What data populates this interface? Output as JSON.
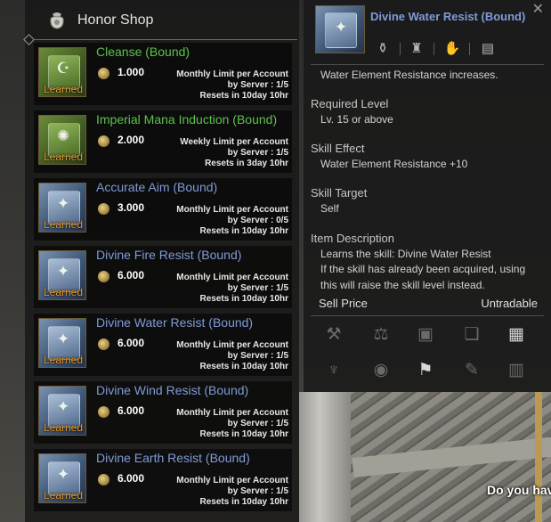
{
  "background": {
    "prompt_text": "Do you hav"
  },
  "shop": {
    "title": "Honor Shop",
    "items": [
      {
        "name": "Cleanse (Bound)",
        "name_color": "green",
        "symbol": "☪",
        "learned": "Learned",
        "price": "1.000",
        "limit_line1": "Monthly Limit per Account",
        "limit_line2": "by Server : 1/5",
        "limit_line3": "Resets in 10day 10hr"
      },
      {
        "name": "Imperial Mana Induction (Bound)",
        "name_color": "green",
        "symbol": "✺",
        "learned": "Learned",
        "price": "2.000",
        "limit_line1": "Weekly Limit per Account",
        "limit_line2": "by Server : 1/5",
        "limit_line3": "Resets in 3day 10hr"
      },
      {
        "name": "Accurate Aim (Bound)",
        "name_color": "blue",
        "symbol": "✦",
        "learned": "Learned",
        "price": "3.000",
        "limit_line1": "Monthly Limit per Account",
        "limit_line2": "by Server : 0/5",
        "limit_line3": "Resets in 10day 10hr"
      },
      {
        "name": "Divine Fire Resist (Bound)",
        "name_color": "blue",
        "symbol": "✦",
        "learned": "Learned",
        "price": "6.000",
        "limit_line1": "Monthly Limit per Account",
        "limit_line2": "by Server : 1/5",
        "limit_line3": "Resets in 10day 10hr"
      },
      {
        "name": "Divine Water Resist (Bound)",
        "name_color": "blue",
        "symbol": "✦",
        "learned": "Learned",
        "price": "6.000",
        "limit_line1": "Monthly Limit per Account",
        "limit_line2": "by Server : 1/5",
        "limit_line3": "Resets in 10day 10hr"
      },
      {
        "name": "Divine Wind Resist (Bound)",
        "name_color": "blue",
        "symbol": "✦",
        "learned": "Learned",
        "price": "6.000",
        "limit_line1": "Monthly Limit per Account",
        "limit_line2": "by Server : 1/5",
        "limit_line3": "Resets in 10day 10hr"
      },
      {
        "name": "Divine Earth Resist (Bound)",
        "name_color": "blue",
        "symbol": "✦",
        "learned": "Learned",
        "price": "6.000",
        "limit_line1": "Monthly Limit per Account",
        "limit_line2": "by Server : 1/5",
        "limit_line3": "Resets in 10day 10hr"
      }
    ]
  },
  "tooltip": {
    "title": "Divine Water Resist (Bound)",
    "symbol": "✦",
    "tag_icons": [
      "pouch-icon",
      "trade-bag-icon",
      "handshake-icon",
      "storage-chest-icon"
    ],
    "summary": "Water Element Resistance increases.",
    "required_level_heading": "Required Level",
    "required_level_value": "Lv. 15 or above",
    "skill_effect_heading": "Skill Effect",
    "skill_effect_value": "Water Element Resistance +10",
    "skill_target_heading": "Skill Target",
    "skill_target_value": "Self",
    "item_description_heading": "Item Description",
    "desc_line1": "Learns the skill: Divine Water Resist",
    "desc_line2": "If the skill has already been acquired, using",
    "desc_line3": "this will raise the skill level instead.",
    "sell_price_label": "Sell Price",
    "sell_price_value": "Untradable",
    "action_icons_row1": [
      "anvil-icon",
      "scale-icon",
      "scroll-icon",
      "cards-icon",
      "calculator-icon"
    ],
    "action_icons_row2": [
      "helmet-icon",
      "orb-icon",
      "map-icon",
      "hammer-icon",
      "trash-icon"
    ]
  }
}
